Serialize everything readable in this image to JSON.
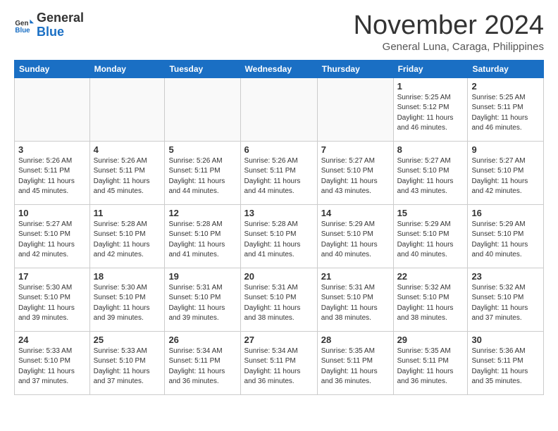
{
  "header": {
    "logo_general": "General",
    "logo_blue": "Blue",
    "month": "November 2024",
    "location": "General Luna, Caraga, Philippines"
  },
  "days_of_week": [
    "Sunday",
    "Monday",
    "Tuesday",
    "Wednesday",
    "Thursday",
    "Friday",
    "Saturday"
  ],
  "weeks": [
    [
      {
        "day": "",
        "info": ""
      },
      {
        "day": "",
        "info": ""
      },
      {
        "day": "",
        "info": ""
      },
      {
        "day": "",
        "info": ""
      },
      {
        "day": "",
        "info": ""
      },
      {
        "day": "1",
        "info": "Sunrise: 5:25 AM\nSunset: 5:12 PM\nDaylight: 11 hours and 46 minutes."
      },
      {
        "day": "2",
        "info": "Sunrise: 5:25 AM\nSunset: 5:11 PM\nDaylight: 11 hours and 46 minutes."
      }
    ],
    [
      {
        "day": "3",
        "info": "Sunrise: 5:26 AM\nSunset: 5:11 PM\nDaylight: 11 hours and 45 minutes."
      },
      {
        "day": "4",
        "info": "Sunrise: 5:26 AM\nSunset: 5:11 PM\nDaylight: 11 hours and 45 minutes."
      },
      {
        "day": "5",
        "info": "Sunrise: 5:26 AM\nSunset: 5:11 PM\nDaylight: 11 hours and 44 minutes."
      },
      {
        "day": "6",
        "info": "Sunrise: 5:26 AM\nSunset: 5:11 PM\nDaylight: 11 hours and 44 minutes."
      },
      {
        "day": "7",
        "info": "Sunrise: 5:27 AM\nSunset: 5:10 PM\nDaylight: 11 hours and 43 minutes."
      },
      {
        "day": "8",
        "info": "Sunrise: 5:27 AM\nSunset: 5:10 PM\nDaylight: 11 hours and 43 minutes."
      },
      {
        "day": "9",
        "info": "Sunrise: 5:27 AM\nSunset: 5:10 PM\nDaylight: 11 hours and 42 minutes."
      }
    ],
    [
      {
        "day": "10",
        "info": "Sunrise: 5:27 AM\nSunset: 5:10 PM\nDaylight: 11 hours and 42 minutes."
      },
      {
        "day": "11",
        "info": "Sunrise: 5:28 AM\nSunset: 5:10 PM\nDaylight: 11 hours and 42 minutes."
      },
      {
        "day": "12",
        "info": "Sunrise: 5:28 AM\nSunset: 5:10 PM\nDaylight: 11 hours and 41 minutes."
      },
      {
        "day": "13",
        "info": "Sunrise: 5:28 AM\nSunset: 5:10 PM\nDaylight: 11 hours and 41 minutes."
      },
      {
        "day": "14",
        "info": "Sunrise: 5:29 AM\nSunset: 5:10 PM\nDaylight: 11 hours and 40 minutes."
      },
      {
        "day": "15",
        "info": "Sunrise: 5:29 AM\nSunset: 5:10 PM\nDaylight: 11 hours and 40 minutes."
      },
      {
        "day": "16",
        "info": "Sunrise: 5:29 AM\nSunset: 5:10 PM\nDaylight: 11 hours and 40 minutes."
      }
    ],
    [
      {
        "day": "17",
        "info": "Sunrise: 5:30 AM\nSunset: 5:10 PM\nDaylight: 11 hours and 39 minutes."
      },
      {
        "day": "18",
        "info": "Sunrise: 5:30 AM\nSunset: 5:10 PM\nDaylight: 11 hours and 39 minutes."
      },
      {
        "day": "19",
        "info": "Sunrise: 5:31 AM\nSunset: 5:10 PM\nDaylight: 11 hours and 39 minutes."
      },
      {
        "day": "20",
        "info": "Sunrise: 5:31 AM\nSunset: 5:10 PM\nDaylight: 11 hours and 38 minutes."
      },
      {
        "day": "21",
        "info": "Sunrise: 5:31 AM\nSunset: 5:10 PM\nDaylight: 11 hours and 38 minutes."
      },
      {
        "day": "22",
        "info": "Sunrise: 5:32 AM\nSunset: 5:10 PM\nDaylight: 11 hours and 38 minutes."
      },
      {
        "day": "23",
        "info": "Sunrise: 5:32 AM\nSunset: 5:10 PM\nDaylight: 11 hours and 37 minutes."
      }
    ],
    [
      {
        "day": "24",
        "info": "Sunrise: 5:33 AM\nSunset: 5:10 PM\nDaylight: 11 hours and 37 minutes."
      },
      {
        "day": "25",
        "info": "Sunrise: 5:33 AM\nSunset: 5:10 PM\nDaylight: 11 hours and 37 minutes."
      },
      {
        "day": "26",
        "info": "Sunrise: 5:34 AM\nSunset: 5:11 PM\nDaylight: 11 hours and 36 minutes."
      },
      {
        "day": "27",
        "info": "Sunrise: 5:34 AM\nSunset: 5:11 PM\nDaylight: 11 hours and 36 minutes."
      },
      {
        "day": "28",
        "info": "Sunrise: 5:35 AM\nSunset: 5:11 PM\nDaylight: 11 hours and 36 minutes."
      },
      {
        "day": "29",
        "info": "Sunrise: 5:35 AM\nSunset: 5:11 PM\nDaylight: 11 hours and 36 minutes."
      },
      {
        "day": "30",
        "info": "Sunrise: 5:36 AM\nSunset: 5:11 PM\nDaylight: 11 hours and 35 minutes."
      }
    ]
  ]
}
